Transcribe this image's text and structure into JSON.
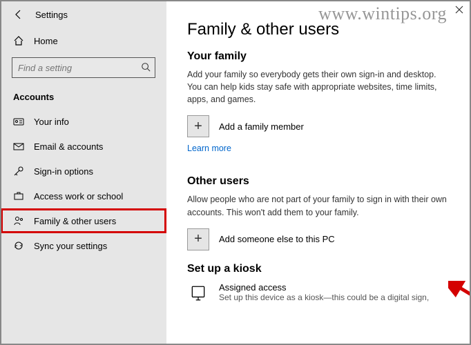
{
  "app_title": "Settings",
  "home_label": "Home",
  "search_placeholder": "Find a setting",
  "section_header": "Accounts",
  "nav_items": [
    {
      "label": "Your info"
    },
    {
      "label": "Email & accounts"
    },
    {
      "label": "Sign-in options"
    },
    {
      "label": "Access work or school"
    },
    {
      "label": "Family & other users"
    },
    {
      "label": "Sync your settings"
    }
  ],
  "page": {
    "title": "Family & other users",
    "family": {
      "header": "Your family",
      "desc": "Add your family so everybody gets their own sign-in and desktop. You can help kids stay safe with appropriate websites, time limits, apps, and games.",
      "add_label": "Add a family member",
      "learn_more": "Learn more"
    },
    "other": {
      "header": "Other users",
      "desc": "Allow people who are not part of your family to sign in with their own accounts. This won't add them to your family.",
      "add_label": "Add someone else to this PC"
    },
    "kiosk": {
      "header": "Set up a kiosk",
      "title": "Assigned access",
      "sub": "Set up this device as a kiosk—this could be a digital sign,"
    }
  },
  "watermark": "www.wintips.org"
}
